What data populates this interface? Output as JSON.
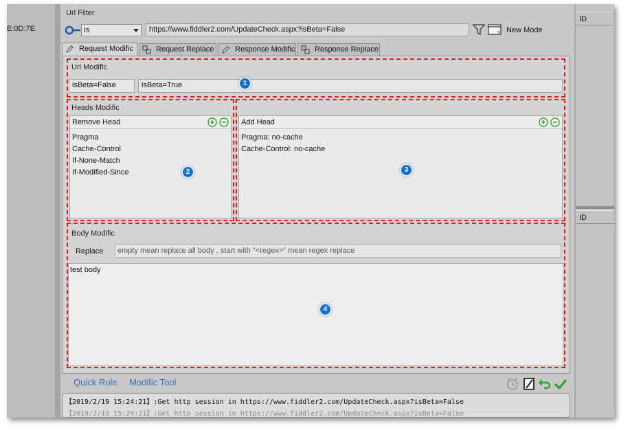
{
  "left_strip": {
    "text": "E:0D:7E"
  },
  "right_pane": {
    "id_label_top": "ID",
    "id_label_bottom": "ID"
  },
  "url_filter": {
    "label": "Url Filter",
    "match_mode": "Is",
    "url": "https://www.fiddler2.com/UpdateCheck.aspx?isBeta=False",
    "new_mode_label": "New Mode"
  },
  "tabs": [
    {
      "label": "Request Modific",
      "active": true
    },
    {
      "label": "Request Replace",
      "active": false
    },
    {
      "label": "Response Modific",
      "active": false
    },
    {
      "label": "Response Replace",
      "active": false
    }
  ],
  "uri_modific": {
    "label": "Uri Modific",
    "old_value": "isBeta=False",
    "new_value": "isBeta=True"
  },
  "heads_modific": {
    "label": "Heads Modific",
    "remove_head": {
      "title": "Remove Head",
      "items": [
        "Pragma",
        "Cache-Control",
        "If-None-Match",
        "If-Modified-Since"
      ]
    },
    "add_head": {
      "title": "Add Head",
      "items": [
        "Pragma: no-cache",
        "Cache-Control: no-cache"
      ]
    }
  },
  "body_modific": {
    "label": "Body Modific",
    "replace_label": "Replace",
    "replace_placeholder": "empty mean replace all body , start with \"<regex>\" mean regex replace",
    "body_text": "test body"
  },
  "badges": [
    "1",
    "2",
    "3",
    "4"
  ],
  "bottom": {
    "quick_rule": "Quick Rule",
    "modific_tool": "Modific Tool"
  },
  "log": {
    "line1": "【2019/2/19 15:24:21】:Get http session in https://www.fiddler2.com/UpdateCheck.aspx?isBeta=False",
    "line2": "【2019/2/19 15:24:21】:Get http session in https://www.fiddler2.com/UpdateCheck.aspx?isBeta=False"
  },
  "colors": {
    "annotation_red": "#d81e1e",
    "badge_blue": "#1470c8",
    "link_blue": "#3a6fb5",
    "confirm_green": "#2aa52a"
  }
}
